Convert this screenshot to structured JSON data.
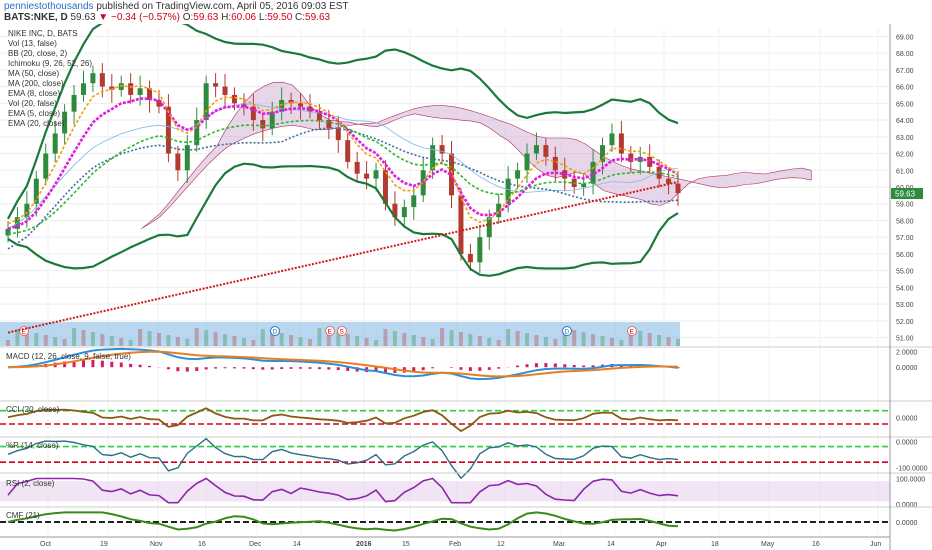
{
  "header": {
    "publisher": "penniestothousands",
    "published_text": "published on TradingView.com, April 05, 2016 09:03 EST",
    "symbol": "BATS:NKE, D",
    "last": "59.63",
    "arrow": "▼",
    "change": "−0.34 (−0.57%)",
    "ohlc_o_label": "O:",
    "ohlc_o": "59.63",
    "ohlc_h_label": "H:",
    "ohlc_h": "60.06",
    "ohlc_l_label": "L:",
    "ohlc_l": "59.50",
    "ohlc_c_label": "C:",
    "ohlc_c": "59.63"
  },
  "legend": [
    "NIKE INC, D, BATS",
    "Vol (13, false)",
    "BB (20, close, 2)",
    "Ichimoku (9, 26, 52, 26)",
    "MA (50, close)",
    "MA (200, close)",
    "EMA (8, close)",
    "Vol (20, false)",
    "EMA (5, close)",
    "EMA (20, close)"
  ],
  "colors": {
    "up": "#2e8b3e",
    "down": "#b23a2e",
    "bb": "#1b7a3a",
    "ma50": "#3a6f9a",
    "ma200": "#d01818",
    "ema8": "#e01ce0",
    "ema5": "#f39c12",
    "ema20": "#2eb82e",
    "ichimoku_cloud": "#c9a3cf",
    "volume": "#7fb7e6",
    "macd": "#2e8fd8",
    "macd_signal": "#e67e22",
    "macd_hist": "#d81b60",
    "cci": "#8a5a12",
    "wr": "#2a6f8a",
    "rsi": "#8e24aa",
    "cmf": "#3a8a1a",
    "green_dash": "#2ecc40",
    "red_dash": "#d0021b",
    "price_tag": "#2e8b3e"
  },
  "price_tag": "59.63",
  "chart_data": [
    {
      "type": "candlestick",
      "title": "NIKE INC, D, BATS",
      "x_ticks": [
        "Oct",
        "19",
        "Nov",
        "16",
        "Dec",
        "14",
        "2016",
        "15",
        "Feb",
        "12",
        "Mar",
        "14",
        "Apr",
        "18",
        "May",
        "16",
        "Jun"
      ],
      "y_ticks": [
        "69.00",
        "68.00",
        "67.00",
        "66.00",
        "65.00",
        "64.00",
        "63.00",
        "62.00",
        "61.00",
        "60.00",
        "59.00",
        "58.00",
        "57.00",
        "56.00",
        "55.00",
        "54.00",
        "53.00",
        "52.00",
        "51.00"
      ],
      "ylim": [
        50.5,
        69.5
      ],
      "close": [
        57.5,
        58.2,
        59.0,
        60.5,
        62.0,
        63.2,
        64.5,
        65.5,
        66.2,
        66.8,
        66.0,
        65.8,
        66.2,
        65.5,
        65.9,
        65.2,
        64.8,
        62.0,
        61.0,
        62.5,
        64.0,
        66.2,
        66.0,
        65.5,
        65.0,
        64.8,
        64.0,
        63.5,
        64.5,
        65.2,
        65.0,
        64.8,
        64.5,
        64.0,
        63.5,
        62.8,
        61.5,
        60.8,
        60.5,
        61.0,
        59.0,
        58.2,
        58.8,
        59.5,
        61.0,
        62.5,
        62.0,
        59.5,
        56.0,
        55.5,
        57.0,
        58.2,
        59.0,
        60.5,
        61.0,
        62.0,
        62.5,
        61.8,
        61.0,
        60.5,
        60.0,
        60.2,
        61.5,
        62.5,
        63.2,
        62.0,
        61.5,
        61.8,
        61.2,
        60.5,
        60.2,
        59.63
      ],
      "series": [
        {
          "name": "MA (200, close)",
          "start": 51.3,
          "end": 60.3
        },
        {
          "name": "BB (20, close, 2)"
        },
        {
          "name": "EMA (8, close)"
        }
      ],
      "annotations": [
        "E",
        "D",
        "E",
        "S",
        "D",
        "E"
      ]
    },
    {
      "type": "line",
      "title": "MACD (12, 26, close, 9, false, true)",
      "y_ticks": [
        "2.0000",
        "0.0000"
      ],
      "ylim": [
        -2.4,
        2.2
      ]
    },
    {
      "type": "line",
      "title": "CCI (20, close)",
      "y_ticks": [
        "0.0000"
      ],
      "ylim": [
        -250,
        200
      ]
    },
    {
      "type": "line",
      "title": "%R (14, close)",
      "y_ticks": [
        "0.0000",
        "-100.0000"
      ],
      "ylim": [
        -110,
        5
      ]
    },
    {
      "type": "line",
      "title": "RSI (2, close)",
      "y_ticks": [
        "100.0000",
        "0.0000"
      ],
      "ylim": [
        0,
        110
      ]
    },
    {
      "type": "line",
      "title": "CMF (21)",
      "y_ticks": [
        "0.0000"
      ],
      "ylim": [
        -0.25,
        0.25
      ]
    }
  ],
  "panels": {
    "macd_label": "MACD (12, 26, close, 9, false, true)",
    "cci_label": "CCI (20, close)",
    "wr_label": "%R (14, close)",
    "rsi_label": "RSI (2, close)",
    "cmf_label": "CMF (21)"
  }
}
